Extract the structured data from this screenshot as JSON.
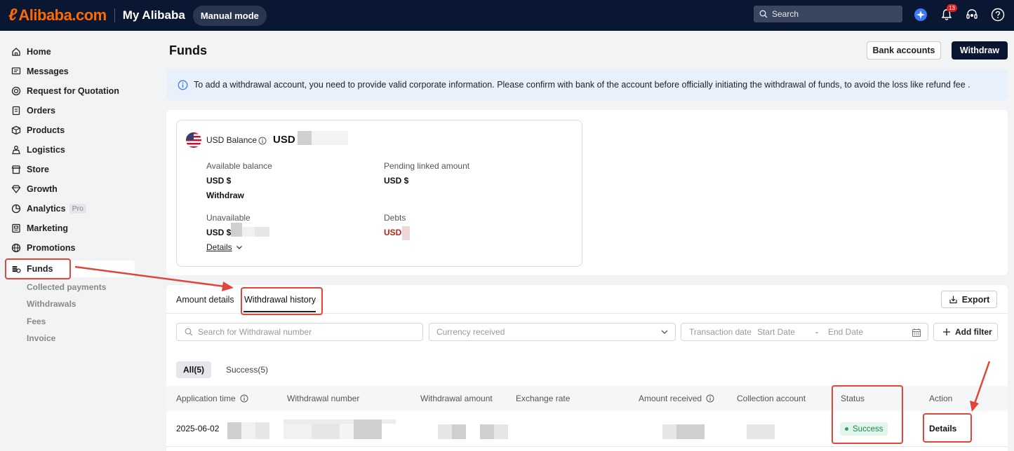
{
  "header": {
    "logo_text": "Alibaba.com",
    "section_title": "My Alibaba",
    "mode_label": "Manual mode",
    "search_placeholder": "Search",
    "notification_count": "13"
  },
  "sidebar": {
    "items": [
      {
        "label": "Home",
        "icon": "home-icon"
      },
      {
        "label": "Messages",
        "icon": "messages-icon"
      },
      {
        "label": "Request for Quotation",
        "icon": "rfq-icon"
      },
      {
        "label": "Orders",
        "icon": "orders-icon"
      },
      {
        "label": "Products",
        "icon": "box-icon"
      },
      {
        "label": "Logistics",
        "icon": "logistics-icon"
      },
      {
        "label": "Store",
        "icon": "store-icon"
      },
      {
        "label": "Growth",
        "icon": "diamond-icon"
      },
      {
        "label": "Analytics",
        "icon": "analytics-icon",
        "tag": "Pro"
      },
      {
        "label": "Marketing",
        "icon": "marketing-icon"
      },
      {
        "label": "Promotions",
        "icon": "globe-icon"
      },
      {
        "label": "Funds",
        "icon": "coins-icon"
      }
    ],
    "sub_items": [
      "Collected payments",
      "Withdrawals",
      "Fees",
      "Invoice"
    ]
  },
  "page": {
    "title": "Funds",
    "bank_accounts_label": "Bank accounts",
    "withdraw_label": "Withdraw",
    "notice": "To add a withdrawal account, you need to provide valid corporate information. Please confirm with bank of the account before officially initiating the withdrawal of funds, to avoid the loss like refund fee ."
  },
  "balance": {
    "title": "USD Balance",
    "currency": "USD",
    "available_label": "Available balance",
    "available_value": "USD $",
    "withdraw_link": "Withdraw",
    "pending_label": "Pending linked amount",
    "pending_value": "USD $",
    "unavailable_label": "Unavailable",
    "unavailable_value": "USD $",
    "details_label": "Details",
    "debts_label": "Debts",
    "debts_value": "USD"
  },
  "tabs": {
    "amount_details": "Amount details",
    "withdrawal_history": "Withdrawal history",
    "export_label": "Export"
  },
  "filters": {
    "search_placeholder": "Search for Withdrawal number",
    "currency_placeholder": "Currency received",
    "date_label": "Transaction date",
    "start_date": "Start Date",
    "date_separator": "-",
    "end_date": "End Date",
    "add_filter": "Add filter"
  },
  "chips": {
    "all": "All(5)",
    "success": "Success(5)"
  },
  "table": {
    "columns": [
      "Application time",
      "Withdrawal number",
      "Withdrawal amount",
      "Exchange rate",
      "Amount received",
      "Collection account",
      "Status",
      "Action"
    ],
    "rows": [
      {
        "application_time": "2025-06-02",
        "status": "Success",
        "action": "Details"
      }
    ]
  },
  "colors": {
    "topbar": "#0a1733",
    "brand_orange": "#ff6a00",
    "annotation_red": "#e0463a",
    "success_green": "#1b8a4a",
    "debts_red": "#b42318"
  }
}
